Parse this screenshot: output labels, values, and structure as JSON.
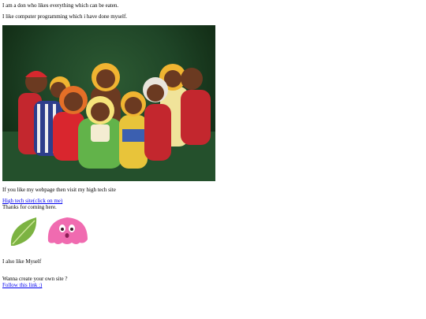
{
  "intro": {
    "line1": "I am a don who likes everything which can be eaten.",
    "line2": "I like computer programming which i have done myself."
  },
  "photo": {
    "icon": "gingerbread-dolls-photo"
  },
  "hightech": {
    "text": "If you like my webpage then visit my high tech site",
    "link": "High tech site(click on me)",
    "thanks": "Thanks for coming here."
  },
  "images": {
    "leaf_icon": "green-leaf-icon",
    "blob_icon": "pink-blob-creature-icon"
  },
  "also": {
    "text": "I also like Myself"
  },
  "create": {
    "text": "Wanna create your own site ?",
    "link": "Follow this link :)"
  },
  "colors": {
    "link": "#0000ee",
    "leaf": "#7cb342",
    "blob": "#f06bb0"
  }
}
